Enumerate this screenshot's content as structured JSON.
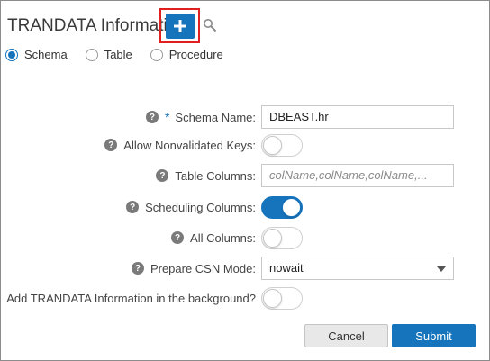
{
  "header": {
    "title": "TRANDATA Information",
    "add_icon": "plus-icon",
    "search_icon": "search-icon",
    "accent_color": "#1674bd",
    "highlight_color": "#e02020"
  },
  "mode": {
    "options": [
      {
        "label": "Schema",
        "checked": true
      },
      {
        "label": "Table",
        "checked": false
      },
      {
        "label": "Procedure",
        "checked": false
      }
    ]
  },
  "form": {
    "schema_name": {
      "label": "Schema Name:",
      "required_mark": "*",
      "value": "DBEAST.hr"
    },
    "allow_nonvalidated_keys": {
      "label": "Allow Nonvalidated Keys:",
      "on": false
    },
    "table_columns": {
      "label": "Table Columns:",
      "placeholder": "colName,colName,colName,..."
    },
    "scheduling_columns": {
      "label": "Scheduling Columns:",
      "on": true
    },
    "all_columns": {
      "label": "All Columns:",
      "on": false
    },
    "prepare_csn_mode": {
      "label": "Prepare CSN Mode:",
      "value": "nowait"
    },
    "background": {
      "label": "Add TRANDATA Information in the background?",
      "on": false
    }
  },
  "actions": {
    "cancel_label": "Cancel",
    "submit_label": "Submit"
  }
}
